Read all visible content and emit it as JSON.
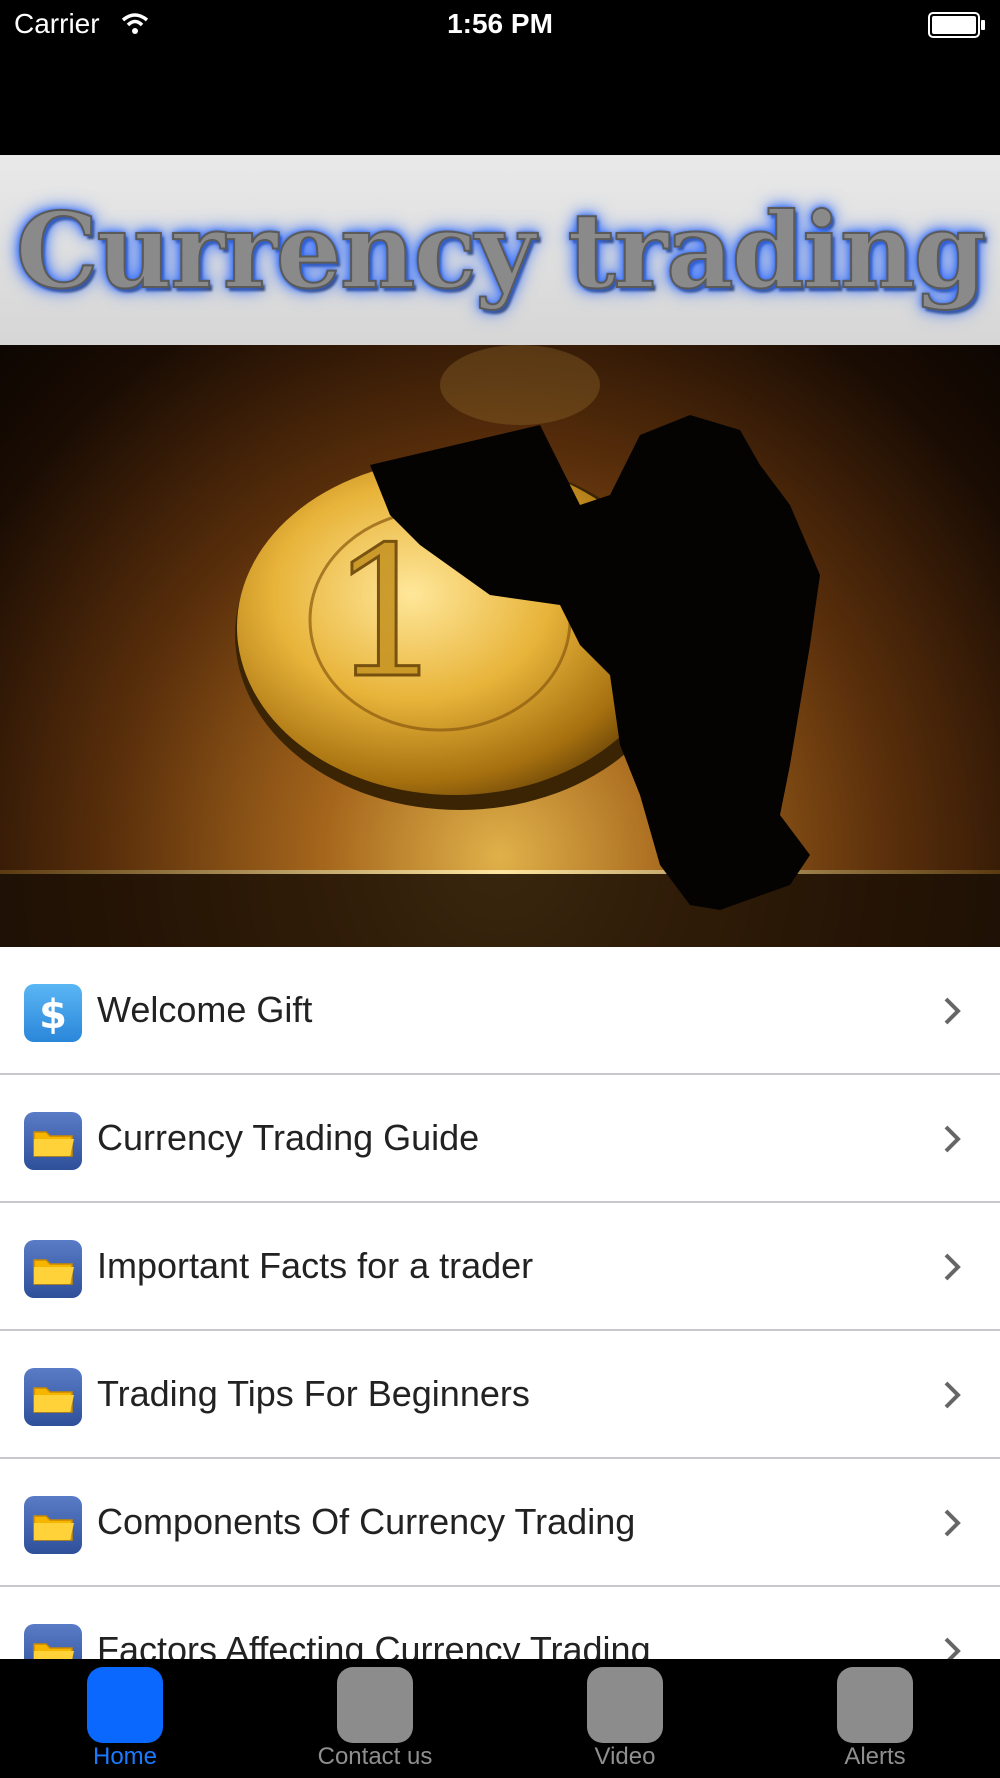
{
  "status_bar": {
    "carrier": "Carrier",
    "time": "1:56 PM"
  },
  "banner": {
    "title": "Currency trading"
  },
  "hero": {
    "description_icon": "coin-and-silhouette-image"
  },
  "menu": {
    "items": [
      {
        "label": "Welcome Gift",
        "icon": "dollar-icon"
      },
      {
        "label": "Currency Trading Guide",
        "icon": "folder-icon"
      },
      {
        "label": "Important Facts for a trader",
        "icon": "folder-icon"
      },
      {
        "label": "Trading Tips For Beginners",
        "icon": "folder-icon"
      },
      {
        "label": "Components Of Currency Trading",
        "icon": "folder-icon"
      },
      {
        "label": "Factors Affecting Currency Trading",
        "icon": "folder-icon"
      }
    ]
  },
  "tab_bar": {
    "tabs": [
      {
        "label": "Home",
        "active": true
      },
      {
        "label": "Contact us",
        "active": false
      },
      {
        "label": "Video",
        "active": false
      },
      {
        "label": "Alerts",
        "active": false
      }
    ]
  },
  "colors": {
    "accent": "#0a68ff",
    "tab_inactive": "#8c8c8c",
    "divider": "#c8c8cc"
  }
}
